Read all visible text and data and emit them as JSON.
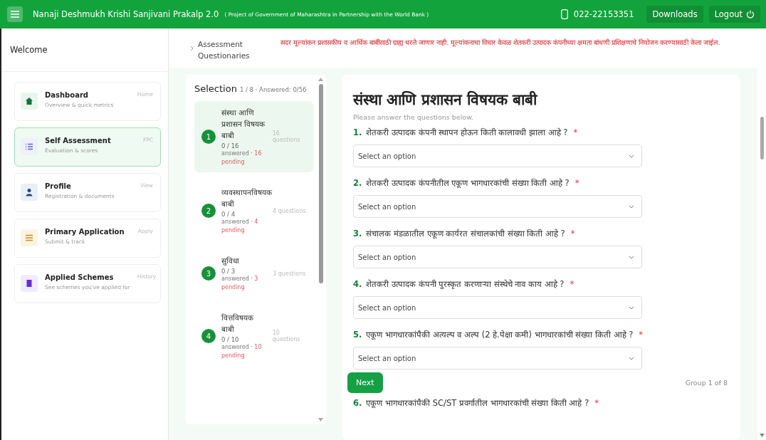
{
  "header": {
    "title": "Nanaji Deshmukh Krishi Sanjivani Prakalp 2.0",
    "subtitle": "( Project of Government of Maharashtra in Partnership with the World Bank )",
    "phone": "022-22153351",
    "downloads": "Downloads",
    "logout": "Logout"
  },
  "sidebar": {
    "welcome": "Welcome",
    "items": [
      {
        "title": "Dashboard",
        "subtitle": "Overview & quick metrics",
        "tag": "Home",
        "kind": "home",
        "selected": false
      },
      {
        "title": "Self Assessment",
        "subtitle": "Evaluation & scores",
        "tag": "FPC",
        "kind": "list",
        "selected": true
      },
      {
        "title": "Profile",
        "subtitle": "Registration & documents",
        "tag": "View",
        "kind": "person",
        "selected": false
      },
      {
        "title": "Primary Application",
        "subtitle": "Submit & track",
        "tag": "Apply",
        "kind": "lines",
        "selected": false
      },
      {
        "title": "Applied Schemes",
        "subtitle": "See schemes you've applied for",
        "tag": "History",
        "kind": "bookmark",
        "selected": false
      }
    ]
  },
  "breadcrumb": "Assessment Questionaries",
  "notice": "सदर मूल्यांकन प्रशासकीय व आर्थिक बाबींसाठी ग्राह्य धरले जाणार नाही. मूल्यांकनाचा विचार केवळ शेतकरी उत्पादक कंपनीच्या क्षमता बांधणी प्रशिक्षणाचे नियोजन करण्यासाठी केला जाईल.",
  "selection": {
    "title": "Selection",
    "summary": "1 / 8 · Answered: 0/56",
    "groups": [
      {
        "number": "1",
        "title": "संस्था आणि प्रशासन विषयक बाबी",
        "count": "0 / 16",
        "answered": "answered ·",
        "pending": "16 pending",
        "questions": "16 questions",
        "selected": true
      },
      {
        "number": "2",
        "title": "व्यवस्थापनविषयक बाबी",
        "count": "0 / 4",
        "answered": "answered ·",
        "pending": "4 pending",
        "questions": "4 questions",
        "selected": false
      },
      {
        "number": "3",
        "title": "सुविधा",
        "count": "0 / 3",
        "answered": "answered ·",
        "pending": "3 pending",
        "questions": "3 questions",
        "selected": false
      },
      {
        "number": "4",
        "title": "वित्तविषयक बाबी",
        "count": "0 / 10",
        "answered": "answered ·",
        "pending": "10 pending",
        "questions": "10 questions",
        "selected": false
      }
    ]
  },
  "form": {
    "title": "संस्था आणि प्रशासन विषयक बाबी",
    "hint": "Please answer the questions below.",
    "questions": [
      {
        "number": "1.",
        "text": "शेतकरी उत्पादक कंपनी स्थापन होऊन किती कालावधी झाला आहे ?",
        "mark": "*",
        "placeholder": "Select an option"
      },
      {
        "number": "2.",
        "text": "शेतकरी उत्पादक कंपनीतील एकूण भागधारकांची संख्या किती आहे ?",
        "mark": "*",
        "placeholder": "Select an option"
      },
      {
        "number": "3.",
        "text": "संचालक मंडळातील एकूण कार्यरत संचालकांची संख्या किती आहे ?",
        "mark": "*",
        "placeholder": "Select an option"
      },
      {
        "number": "4.",
        "text": "शेतकरी उत्पादक कंपनी पुरस्कृत करणाऱ्या संस्थेचे नाव काय आहे ?",
        "mark": "*",
        "placeholder": "Select an option"
      },
      {
        "number": "5.",
        "text": "एकूण भागधारकांपैकी अत्यल्प व अल्प (2 हे.पेक्षा कमी) भागधारकांची संख्या किती आहे ?",
        "mark": "*",
        "placeholder": "Select an option"
      }
    ],
    "next": "Next",
    "group": "Group 1 of 8",
    "partial_question": {
      "number": "6.",
      "text": "एकूण भागधारकांपैकी SC/ST प्रवर्गातील भागधारकांची संख्या किती आहे ?",
      "mark": "*"
    }
  }
}
